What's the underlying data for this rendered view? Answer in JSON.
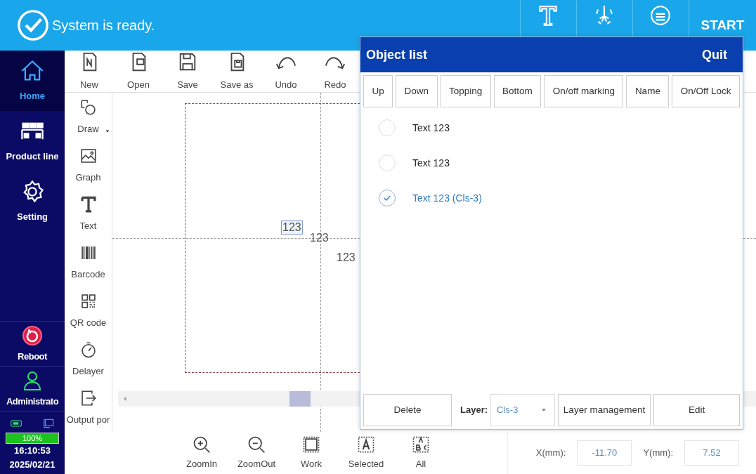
{
  "header": {
    "status": "System is ready.",
    "tools": [
      {
        "kind": "text-tool"
      },
      {
        "kind": "laser"
      },
      {
        "kind": "info"
      }
    ],
    "start": "START"
  },
  "sidebar": {
    "items": [
      {
        "label": "Home",
        "kind": "home",
        "selected": true
      },
      {
        "label": "Product line",
        "kind": "line",
        "selected": false
      },
      {
        "label": "Setting",
        "kind": "gear",
        "selected": false
      }
    ],
    "bottom_items": [
      {
        "label": "Reboot",
        "kind": "reboot"
      },
      {
        "label": "Administrato",
        "kind": "user"
      }
    ],
    "battery": {
      "level": 1,
      "reading": "100%"
    },
    "time": "16:10:53",
    "date": "2025/02/21"
  },
  "toolbar": [
    {
      "label": "New",
      "kind": "new"
    },
    {
      "label": "Open",
      "kind": "open"
    },
    {
      "label": "Save",
      "kind": "save"
    },
    {
      "label": "Save as",
      "kind": "saveas"
    },
    {
      "label": "Undo",
      "kind": "undo"
    },
    {
      "label": "Redo",
      "kind": "redo"
    }
  ],
  "tools": [
    {
      "label": "Draw",
      "kind": "draw",
      "dropdown": true
    },
    {
      "label": "Graph",
      "kind": "graph",
      "dropdown": false
    },
    {
      "label": "Text",
      "kind": "text",
      "dropdown": false
    },
    {
      "label": "Barcode",
      "kind": "barcode",
      "dropdown": false
    },
    {
      "label": "QR code",
      "kind": "qr",
      "dropdown": false
    },
    {
      "label": "Delayer",
      "kind": "timer",
      "dropdown": false
    },
    {
      "label": "Output por",
      "kind": "output",
      "dropdown": false
    }
  ],
  "canvas": {
    "objects": [
      {
        "text": "123",
        "selected": true
      },
      {
        "text": "123",
        "selected": false
      },
      {
        "text": "123",
        "selected": false
      }
    ]
  },
  "view_buttons": [
    {
      "label": "ZoomIn",
      "kind": "zoomin"
    },
    {
      "label": "ZoomOut",
      "kind": "zoomout"
    },
    {
      "label": "Work",
      "kind": "work"
    },
    {
      "label": "Selected",
      "kind": "sel"
    },
    {
      "label": "All",
      "kind": "all"
    }
  ],
  "coordinates": [
    {
      "label": "X(mm):",
      "value": "-11.70"
    },
    {
      "label": "Y(mm):",
      "value": "7.52"
    }
  ],
  "object_list": {
    "title": "Object list",
    "quit": "Quit",
    "buttons": [
      "Up",
      "Down",
      "Topping",
      "Bottom",
      "On/off marking",
      "Name",
      "On/Off Lock"
    ],
    "items": [
      {
        "label": "Text 123",
        "checked": false
      },
      {
        "label": "Text 123",
        "checked": false
      },
      {
        "label": "Text 123 (Cls-3)",
        "checked": true
      }
    ],
    "delete": "Delete",
    "layer_label": "Layer:",
    "layer_value": "Cls-3",
    "layer_management": "Layer management",
    "edit": "Edit"
  }
}
